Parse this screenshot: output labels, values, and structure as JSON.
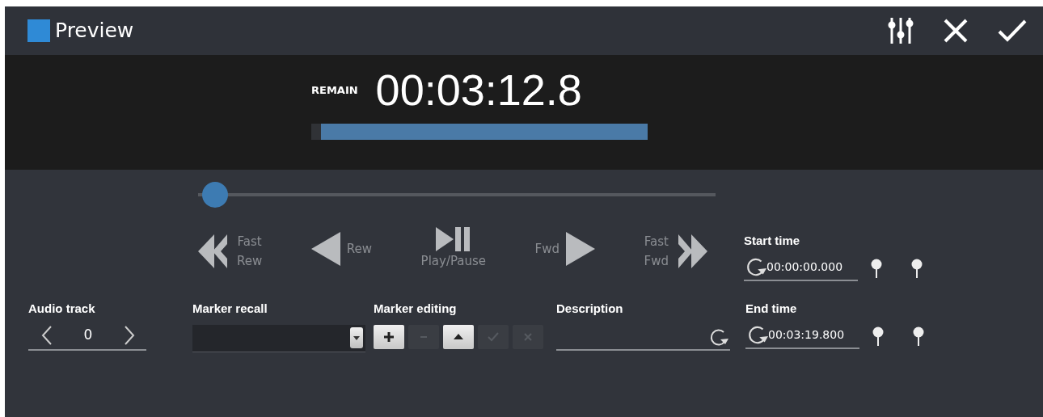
{
  "window": {
    "title": "Preview"
  },
  "countdown": {
    "label": "REMAIN",
    "time": "00:03:12.8",
    "level": 0.97
  },
  "seek_slider": {
    "level": 0.03
  },
  "transport": [
    {
      "kind": "fast-rewind",
      "lines": [
        "Fast",
        "Rew"
      ]
    },
    {
      "kind": "rewind",
      "lines": [
        "Rew"
      ]
    },
    {
      "kind": "play-pause",
      "lines": [
        "Play/Pause"
      ]
    },
    {
      "kind": "forward",
      "lines": [
        "Fwd"
      ]
    },
    {
      "kind": "fast-forward",
      "lines": [
        "Fast",
        "Fwd"
      ]
    }
  ],
  "start_time": {
    "label": "Start time",
    "value": "00:00:00.000"
  },
  "audio_track": {
    "label": "Audio track",
    "value": "0"
  },
  "marker_recall": {
    "label": "Marker recall"
  },
  "marker_editing": {
    "label": "Marker editing",
    "buttons": [
      {
        "kind": "add",
        "disabled": false
      },
      {
        "kind": "remove",
        "disabled": true
      },
      {
        "kind": "move-up",
        "disabled": false
      },
      {
        "kind": "accept",
        "disabled": true
      },
      {
        "kind": "cancel",
        "disabled": true
      }
    ]
  },
  "description": {
    "label": "Description"
  },
  "end_time": {
    "label": "End time",
    "value": "00:03:19.800"
  }
}
